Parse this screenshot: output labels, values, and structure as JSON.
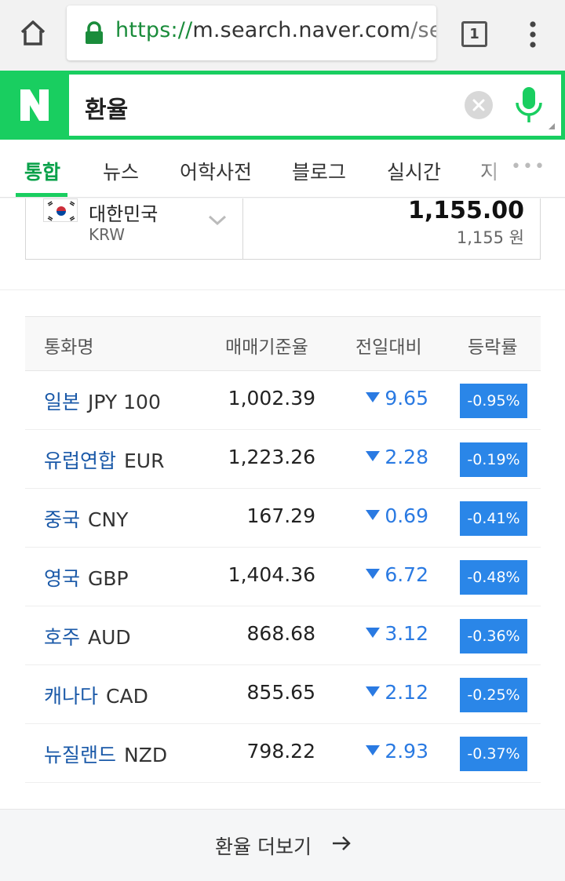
{
  "browser": {
    "url_scheme": "https://",
    "url_host": "m.search.naver.com",
    "url_rest": "/sea",
    "tab_count": "1"
  },
  "search": {
    "logo": "N",
    "query": "환율"
  },
  "nav": {
    "tabs": [
      "통합",
      "뉴스",
      "어학사전",
      "블로그",
      "실시간",
      "지"
    ],
    "active": "통합"
  },
  "converter": {
    "currency_name": "대한민국",
    "currency_code": "KRW",
    "amount": "1,155.00",
    "amount_won": "1,155 원"
  },
  "table": {
    "headers": [
      "통화명",
      "매매기준율",
      "전일대비",
      "등락률"
    ],
    "rows": [
      {
        "name": "일본",
        "code": "JPY 100",
        "rate": "1,002.39",
        "diff": "9.65",
        "pct": "-0.95%"
      },
      {
        "name": "유럽연합",
        "code": "EUR",
        "rate": "1,223.26",
        "diff": "2.28",
        "pct": "-0.19%"
      },
      {
        "name": "중국",
        "code": "CNY",
        "rate": "167.29",
        "diff": "0.69",
        "pct": "-0.41%"
      },
      {
        "name": "영국",
        "code": "GBP",
        "rate": "1,404.36",
        "diff": "6.72",
        "pct": "-0.48%"
      },
      {
        "name": "호주",
        "code": "AUD",
        "rate": "868.68",
        "diff": "3.12",
        "pct": "-0.36%"
      },
      {
        "name": "캐나다",
        "code": "CAD",
        "rate": "855.65",
        "diff": "2.12",
        "pct": "-0.25%"
      },
      {
        "name": "뉴질랜드",
        "code": "NZD",
        "rate": "798.22",
        "diff": "2.93",
        "pct": "-0.37%"
      }
    ]
  },
  "more_label": "환율 더보기",
  "colors": {
    "naver_green": "#19ce60",
    "down_blue": "#2a7ae2",
    "badge_blue": "#2a86e8",
    "link_blue": "#1a59a8"
  }
}
